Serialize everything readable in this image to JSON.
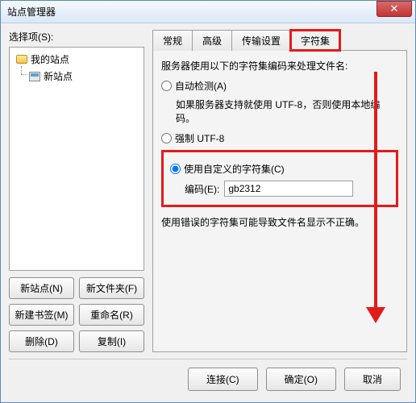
{
  "window": {
    "title": "站点管理器"
  },
  "left": {
    "select_label": "选择项(S):",
    "root": "我的站点",
    "child": "新站点",
    "buttons": {
      "new_site": "新站点(N)",
      "new_folder": "新文件夹(F)",
      "new_bookmark": "新建书签(M)",
      "rename": "重命名(R)",
      "delete": "删除(D)",
      "copy": "复制(I)"
    }
  },
  "tabs": {
    "t0": "常规",
    "t1": "高级",
    "t2": "传输设置",
    "t3": "字符集"
  },
  "panel": {
    "desc": "服务器使用以下的字符集编码来处理文件名:",
    "auto": "自动检测(A)",
    "auto_note": "如果服务器支持就使用 UTF-8，否则使用本地编码。",
    "force": "强制 UTF-8",
    "custom": "使用自定义的字符集(C)",
    "enc_label": "编码(E):",
    "enc_value": "gb2312",
    "warn": "使用错误的字符集可能导致文件名显示不正确。"
  },
  "footer": {
    "connect": "连接(C)",
    "ok": "确定(O)",
    "cancel": "取消"
  }
}
